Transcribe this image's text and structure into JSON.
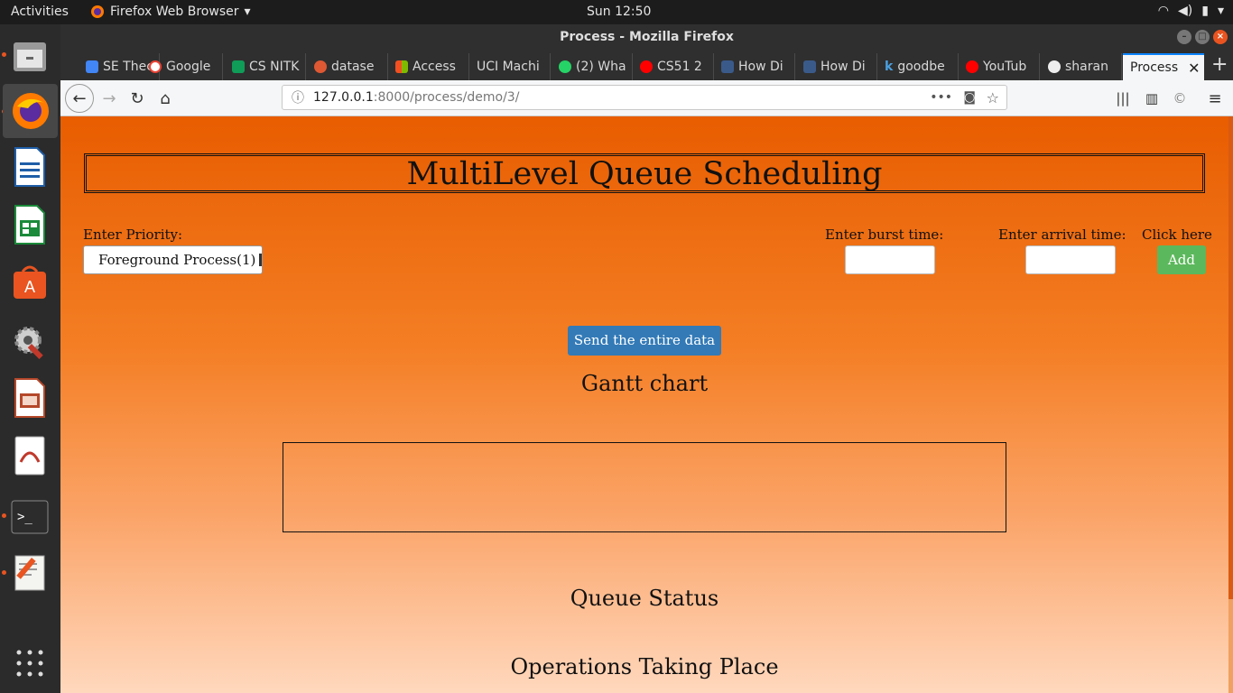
{
  "system": {
    "activities": "Activities",
    "app_name": "Firefox Web Browser",
    "clock": "Sun 12:50"
  },
  "window": {
    "title": "Process - Mozilla Firefox"
  },
  "tabs": [
    {
      "label": "SE Thec",
      "color": "#4285f4"
    },
    {
      "label": "Google",
      "color": "#ea4335"
    },
    {
      "label": "CS NITK",
      "color": "#0f9d58"
    },
    {
      "label": "datase",
      "color": "#de5833"
    },
    {
      "label": "Access",
      "color": "#f25022"
    },
    {
      "label": "UCI Machi",
      "color": "#2f2f2f"
    },
    {
      "label": "(2) Wha",
      "color": "#25d366"
    },
    {
      "label": "CS51 2",
      "color": "#ff0000"
    },
    {
      "label": "How Di",
      "color": "#3a5a8a"
    },
    {
      "label": "How Di",
      "color": "#3a5a8a"
    },
    {
      "label": "goodbe",
      "color": "#4aa0e0"
    },
    {
      "label": "YouTub",
      "color": "#ff0000"
    },
    {
      "label": "sharan",
      "color": "#eeeeee"
    },
    {
      "label": "Process",
      "color": "#f5f6f7"
    }
  ],
  "url": {
    "host": "127.0.0.1",
    "path": ":8000/process/demo/3/"
  },
  "page": {
    "title": "MultiLevel Queue Scheduling",
    "priority_label": "Enter Priority:",
    "priority_selected": "Foreground Process(1)",
    "burst_label": "Enter burst time:",
    "arrival_label": "Enter arrival time:",
    "click_label": "Click here",
    "add_label": "Add",
    "send_label": "Send the entire data",
    "gantt_heading": "Gantt chart",
    "queue_heading": "Queue Status",
    "ops_heading": "Operations Taking Place"
  },
  "colors": {
    "page_top": "#e85d00",
    "add_button": "#5cb85c",
    "send_button": "#337ab7"
  }
}
